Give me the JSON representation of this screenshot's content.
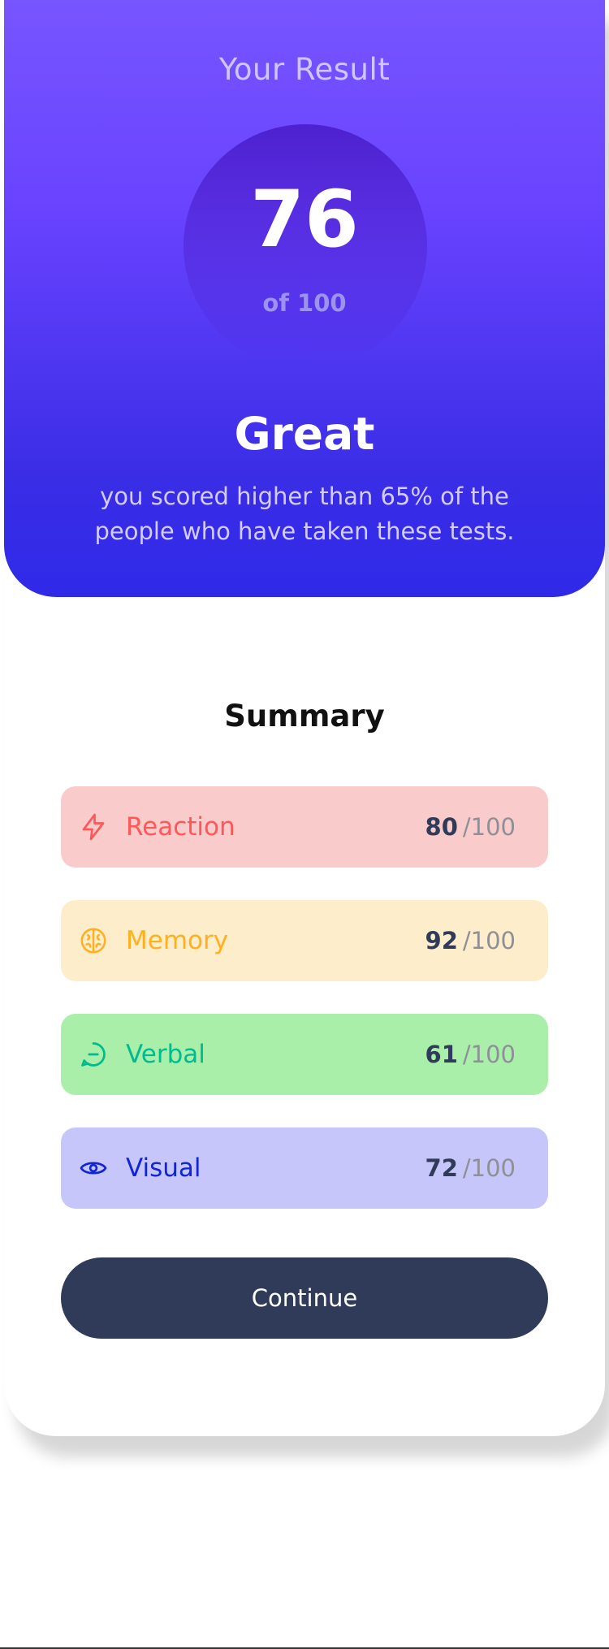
{
  "result": {
    "title": "Your Result",
    "score": "76",
    "score_of": "of 100",
    "rating": "Great",
    "message": "you scored higher than 65% of the people who have taken these tests."
  },
  "summary": {
    "title": "Summary",
    "items": [
      {
        "label": "Reaction",
        "score": "80",
        "max": "/100",
        "icon": "lightning-icon",
        "color": "#ff5757",
        "bg": "#f9cccb"
      },
      {
        "label": "Memory",
        "score": "92",
        "max": "/100",
        "icon": "brain-icon",
        "color": "#ffb01f",
        "bg": "#feedcb"
      },
      {
        "label": "Verbal",
        "score": "61",
        "max": "/100",
        "icon": "chat-bubble-icon",
        "color": "#00bb8f",
        "bg": "#a9efaa"
      },
      {
        "label": "Visual",
        "score": "72",
        "max": "/100",
        "icon": "eye-icon",
        "color": "#1125d4",
        "bg": "#c7c6fa"
      }
    ]
  },
  "actions": {
    "continue_label": "Continue"
  },
  "colors": {
    "gradient_top": "#7755ff",
    "gradient_bottom": "#2f2ae8",
    "button": "#303b5a"
  }
}
